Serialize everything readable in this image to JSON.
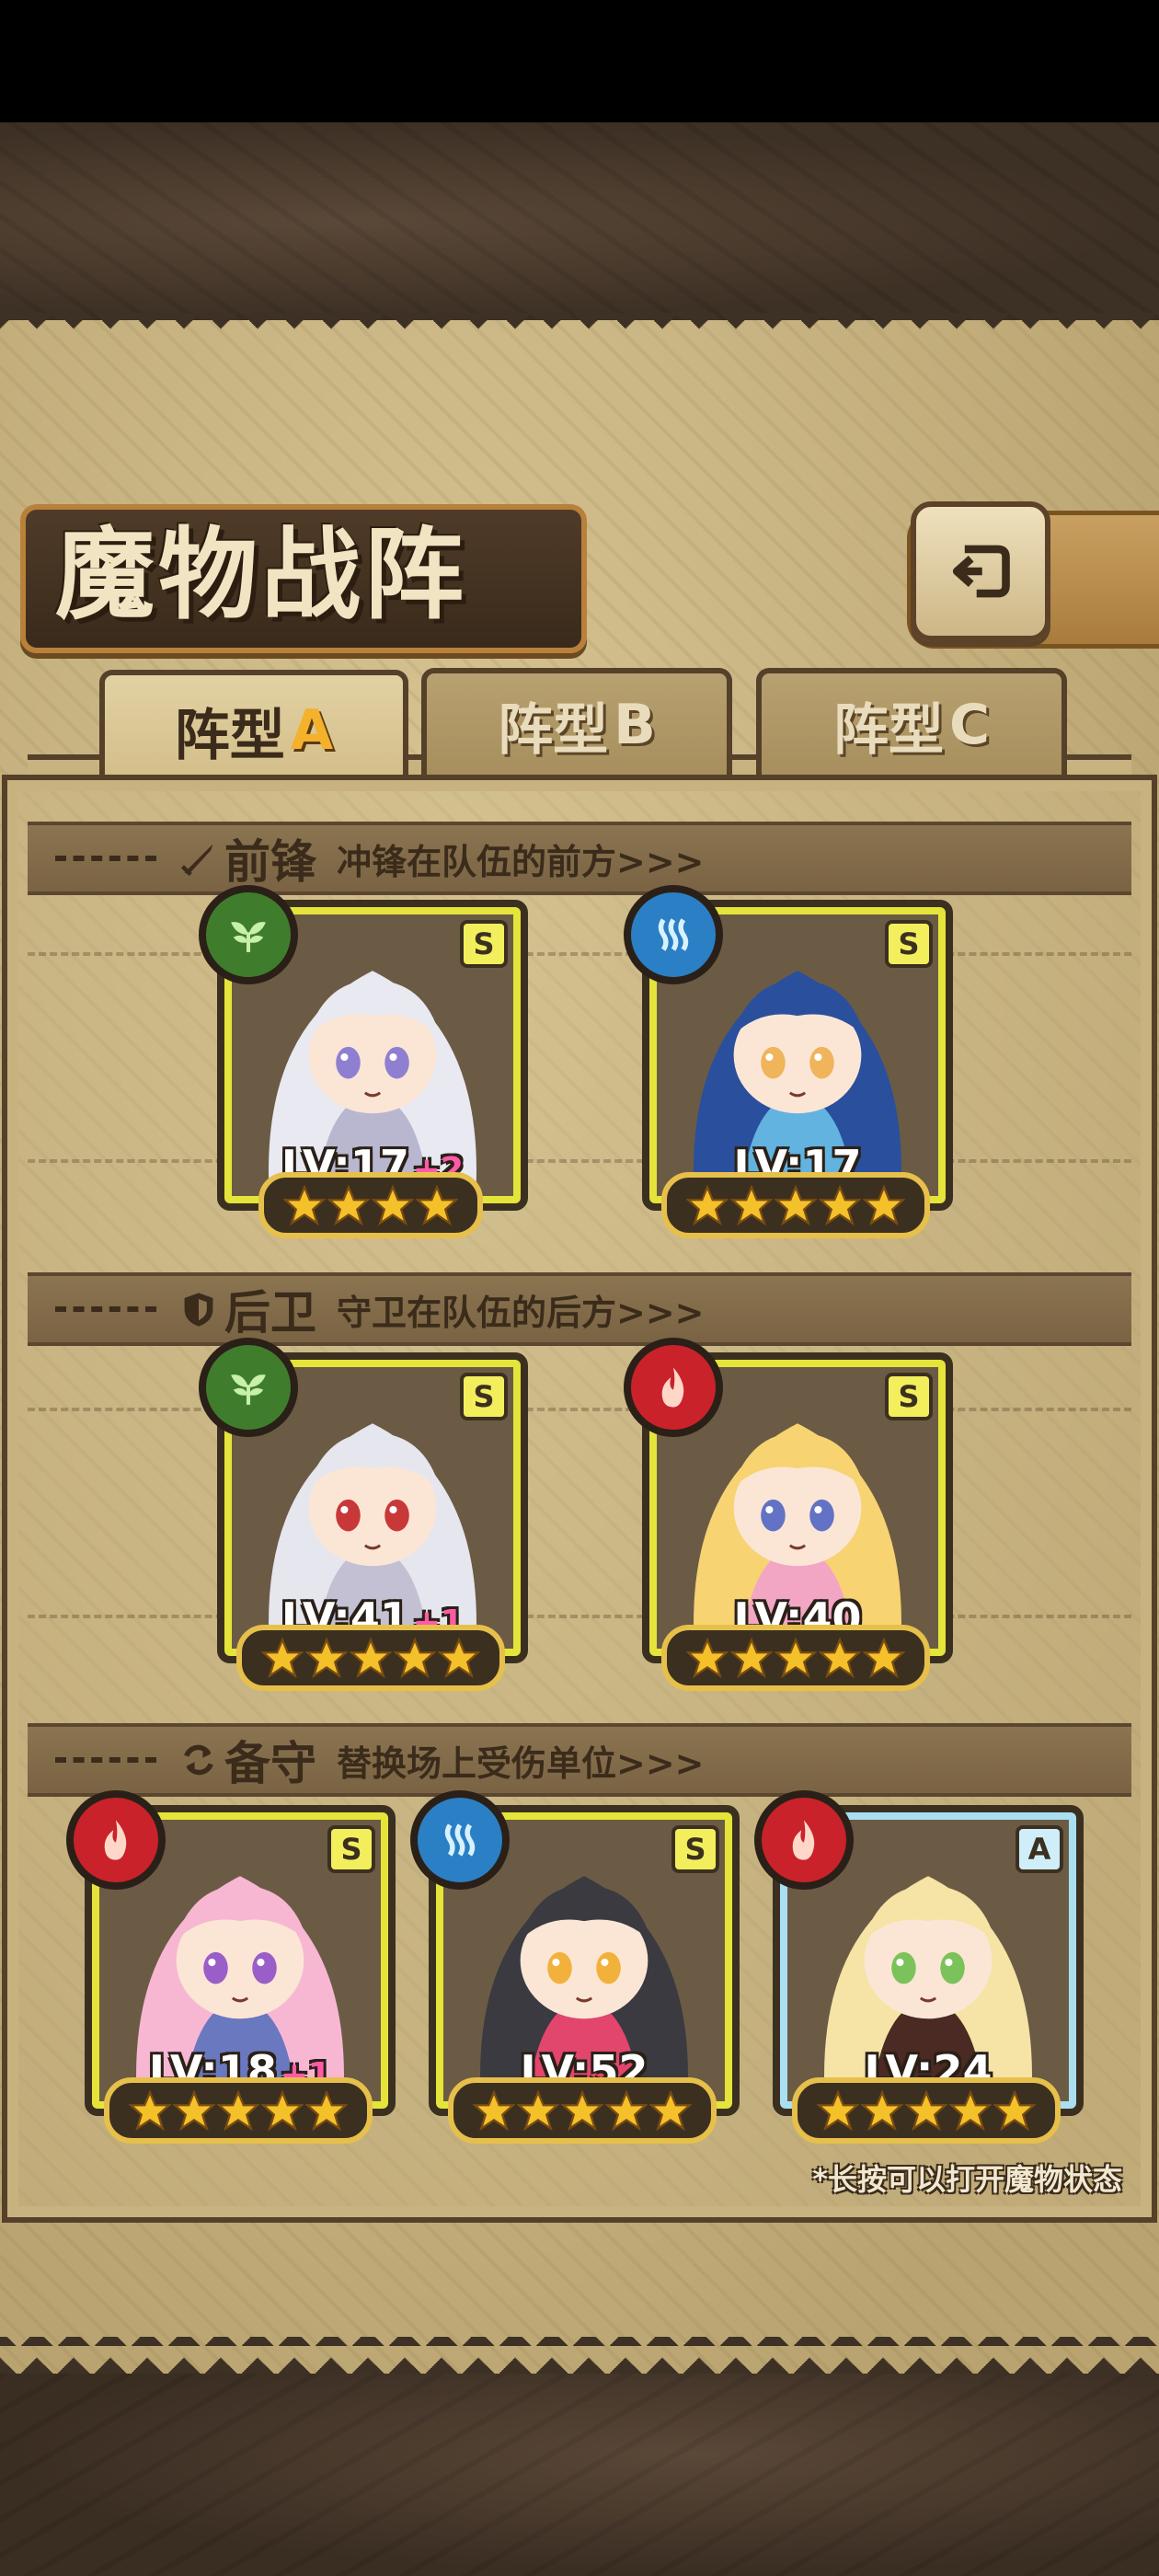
{
  "screen_title": "魔物战阵",
  "tabs": [
    {
      "prefix": "阵型",
      "letter": "A",
      "active": true
    },
    {
      "prefix": "阵型",
      "letter": "B",
      "active": false
    },
    {
      "prefix": "阵型",
      "letter": "C",
      "active": false
    }
  ],
  "sections": {
    "vanguard": {
      "title": "前锋",
      "desc": "冲锋在队伍的前方>>>",
      "icon": "sword-icon"
    },
    "rearguard": {
      "title": "后卫",
      "desc": "守卫在队伍的后方>>>",
      "icon": "shield-icon"
    },
    "reserve": {
      "title": "备守",
      "desc": "替换场上受伤单位>>>",
      "icon": "swap-icon"
    }
  },
  "monsters": {
    "vanguard": [
      {
        "element": "nature",
        "rank": "S",
        "level": "LV:17",
        "bonus": "+2",
        "stars": 4,
        "palette": [
          "#e9e9f2",
          "#b9b7cf",
          "#8f7fd0"
        ]
      },
      {
        "element": "water",
        "rank": "S",
        "level": "LV:17",
        "bonus": "",
        "stars": 5,
        "palette": [
          "#2a4f9c",
          "#62b3df",
          "#f0b45a"
        ]
      }
    ],
    "rearguard": [
      {
        "element": "nature",
        "rank": "S",
        "level": "LV:41",
        "bonus": "+1",
        "stars": 5,
        "palette": [
          "#e6e6ee",
          "#c2c0d2",
          "#c83838"
        ]
      },
      {
        "element": "fire",
        "rank": "S",
        "level": "LV:40",
        "bonus": "",
        "stars": 5,
        "palette": [
          "#f7d372",
          "#f2a6c3",
          "#6272c4"
        ]
      }
    ],
    "reserve": [
      {
        "element": "fire",
        "rank": "S",
        "level": "LV:18",
        "bonus": "+1",
        "stars": 5,
        "palette": [
          "#f7b7d3",
          "#6a78c0",
          "#9a5ec9"
        ]
      },
      {
        "element": "water",
        "rank": "S",
        "level": "LV:52",
        "bonus": "",
        "stars": 5,
        "palette": [
          "#3a3a40",
          "#e2466c",
          "#f2b13a"
        ]
      },
      {
        "element": "fire",
        "rank": "A",
        "level": "LV:24",
        "bonus": "",
        "stars": 5,
        "palette": [
          "#f6e3a6",
          "#4a2a22",
          "#7cc25a"
        ]
      }
    ]
  },
  "footer_hint": "*长按可以打开魔物状态",
  "colors": {
    "panel": "#c9b584",
    "frame": "#55402a",
    "card_border_s": "#e5e43a",
    "card_border_a": "#a9dff1",
    "star": "#f5c12b",
    "bonus": "#ff5aa8"
  }
}
